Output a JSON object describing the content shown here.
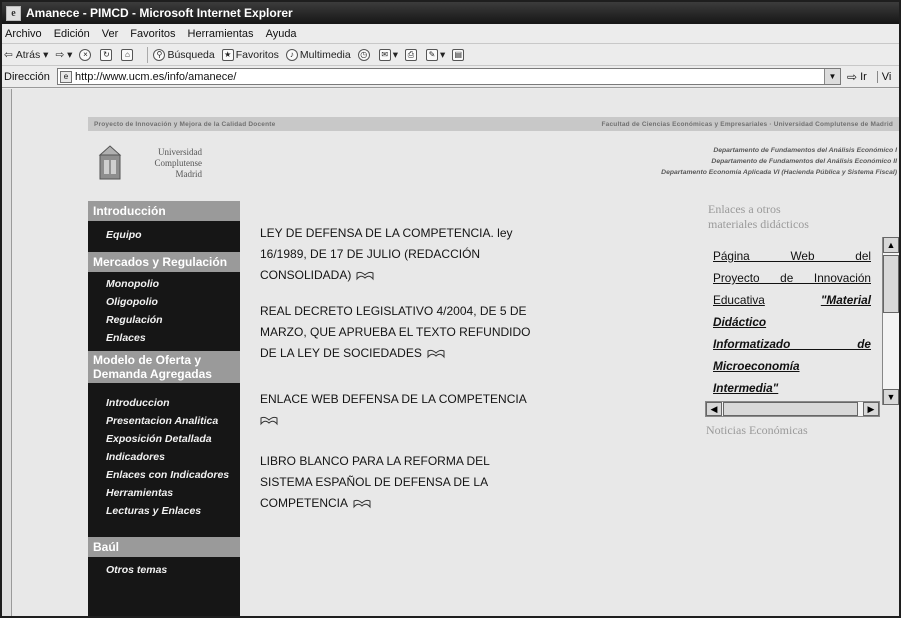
{
  "window": {
    "title": "Amanece - PIMCD - Microsoft Internet Explorer"
  },
  "menu": [
    "Archivo",
    "Edición",
    "Ver",
    "Favoritos",
    "Herramientas",
    "Ayuda"
  ],
  "toolbar": {
    "back": "Atrás",
    "search": "Búsqueda",
    "favorites": "Favoritos",
    "multimedia": "Multimedia"
  },
  "address": {
    "label": "Dirección",
    "url": "http://www.ucm.es/info/amanece/",
    "go_label": "Ir",
    "links_label": "Vi"
  },
  "page": {
    "strip_left": "Proyecto de Innovación y Mejora de la Calidad Docente",
    "strip_right": "Facultad de Ciencias Económicas y Empresariales · Universidad Complutense de Madrid",
    "logo_text": "Universidad Complutense Madrid",
    "departments": [
      "Departamento de Fundamentos del Análisis Económico I",
      "Departamento de Fundamentos del Análisis Económico II",
      "Departamento Economía Aplicada VI (Hacienda Pública y Sistema Fiscal)"
    ],
    "nav": {
      "intro_header": "Introducción",
      "intro_items": [
        "Equipo"
      ],
      "markets_header": "Mercados y Regulación",
      "markets_items": [
        "Monopolio",
        "Oligopolio",
        "Regulación",
        "Enlaces"
      ],
      "model_header": "Modelo de Oferta y Demanda Agregadas",
      "model_items": [
        "Introduccion",
        "Presentacion Analitica",
        "Exposición Detallada",
        "Indicadores",
        "Enlaces con Indicadores",
        "Herramientas",
        "Lecturas y Enlaces"
      ],
      "baul_header": "Baúl",
      "baul_items": [
        "Otros temas"
      ]
    },
    "entries": [
      {
        "lines": [
          "LEY DE DEFENSA DE LA COMPETENCIA. ley",
          "16/1989, DE 17 DE JULIO (REDACCIÓN",
          "CONSOLIDADA)"
        ]
      },
      {
        "lines": [
          "REAL DECRETO LEGISLATIVO 4/2004, DE 5 DE",
          "MARZO, QUE APRUEBA EL TEXTO REFUNDIDO",
          "DE LA LEY DE SOCIEDADES"
        ]
      },
      {
        "lines": [
          "ENLACE WEB DEFENSA DE LA COMPETENCIA"
        ]
      },
      {
        "lines": [
          "LIBRO BLANCO PARA LA REFORMA DEL",
          "SISTEMA ESPAÑOL DE DEFENSA DE LA",
          "COMPETENCIA"
        ]
      }
    ],
    "side": {
      "title_lines": [
        "Enlaces a otros",
        "materiales didácticos"
      ],
      "link_lines": [
        "Página Web del",
        "Proyecto de Innovación",
        "Educativa"
      ],
      "bold_lines": [
        "\"Material",
        "Didáctico",
        "Informatizado de",
        "Microeconomía",
        "Intermedia\""
      ],
      "news": "Noticias Económicas"
    }
  },
  "colors": {
    "nav_bg": "#161616",
    "nav_header": "#9a9a9a",
    "page_bg": "#e8e8e8",
    "strip": "#c8c8c8"
  }
}
